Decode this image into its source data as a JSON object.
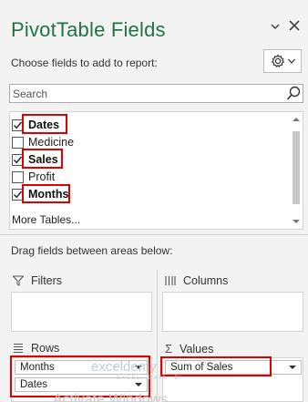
{
  "header": {
    "title": "PivotTable Fields"
  },
  "choose_label": "Choose fields to add to report:",
  "search": {
    "placeholder": "Search",
    "value": ""
  },
  "fields": [
    {
      "label": "Dates",
      "checked": true,
      "bold": true
    },
    {
      "label": "Medicine",
      "checked": false,
      "bold": false
    },
    {
      "label": "Sales",
      "checked": true,
      "bold": true
    },
    {
      "label": "Profit",
      "checked": false,
      "bold": false
    },
    {
      "label": "Months",
      "checked": true,
      "bold": true
    }
  ],
  "more_tables": "More Tables...",
  "drag_label": "Drag fields between areas below:",
  "areas": {
    "filters": {
      "label": "Filters"
    },
    "columns": {
      "label": "Columns"
    },
    "rows": {
      "label": "Rows",
      "items": [
        "Months",
        "Dates"
      ]
    },
    "values": {
      "label": "Values",
      "items": [
        "Sum of Sales"
      ]
    }
  },
  "watermark": {
    "brand": "exceldemy",
    "tagline": "EXCEL · DATA · BI"
  },
  "activation_text": "Activate Windows",
  "colors": {
    "title": "#217346",
    "highlight": "#e10000",
    "panel": "#f3f3f3"
  }
}
